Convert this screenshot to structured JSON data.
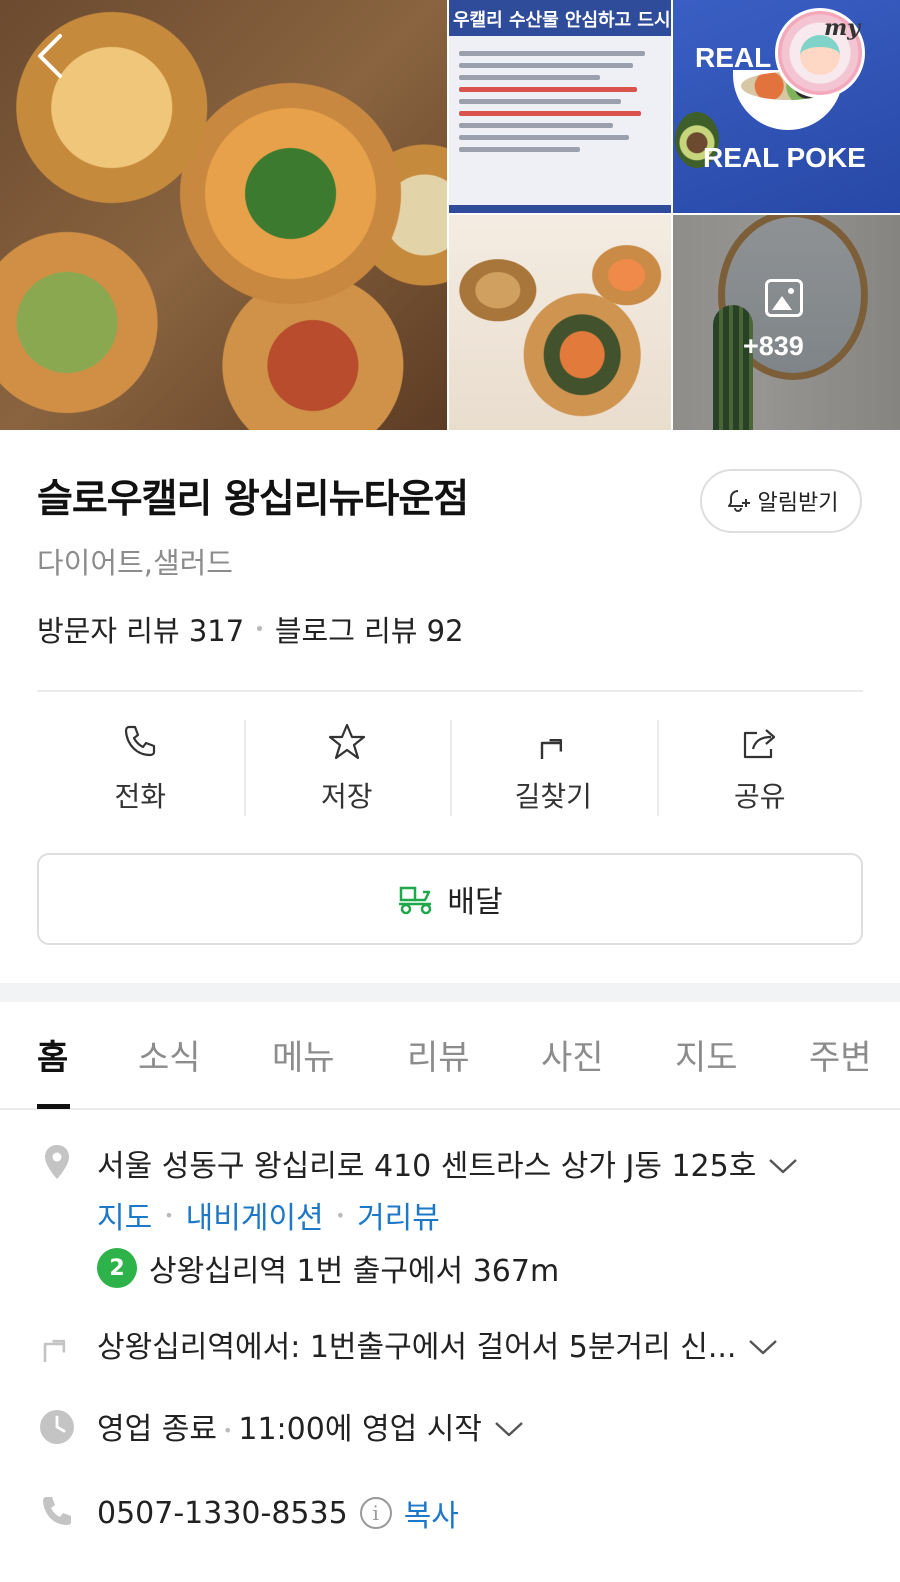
{
  "gallery": {
    "notice_title": "우캘리 수산물 안심하고 드시",
    "poke_top_text": "REAL",
    "poke_bottom_text": "REAL POKE",
    "sticker_text": "my",
    "more_count": "+839"
  },
  "place": {
    "name": "슬로우캘리 왕십리뉴타운점",
    "alert_label": "알림받기",
    "category": "다이어트,샐러드",
    "visitor_reviews": "방문자 리뷰 317",
    "blog_reviews": "블로그 리뷰 92"
  },
  "actions": {
    "call": "전화",
    "save": "저장",
    "directions": "길찾기",
    "share": "공유"
  },
  "delivery_label": "배달",
  "tabs": [
    "홈",
    "소식",
    "메뉴",
    "리뷰",
    "사진",
    "지도",
    "주변"
  ],
  "info": {
    "address": "서울 성동구 왕십리로 410 센트라스 상가 J동 125호",
    "links": [
      "지도",
      "내비게이션",
      "거리뷰"
    ],
    "subway_line": "2",
    "subway_text": "상왕십리역 1번 출구에서 367m",
    "directions_text": "상왕십리역에서: 1번출구에서 걸어서 5분거리 신...",
    "hours_status": "영업 종료",
    "hours_next": "11:00에 영업 시작",
    "phone": "0507-1330-8535",
    "info_symbol": "i",
    "copy_label": "복사"
  },
  "colors": {
    "link_blue": "#1e78c8",
    "subway_green": "#2db34a",
    "delivery_green": "#1fa84a"
  }
}
